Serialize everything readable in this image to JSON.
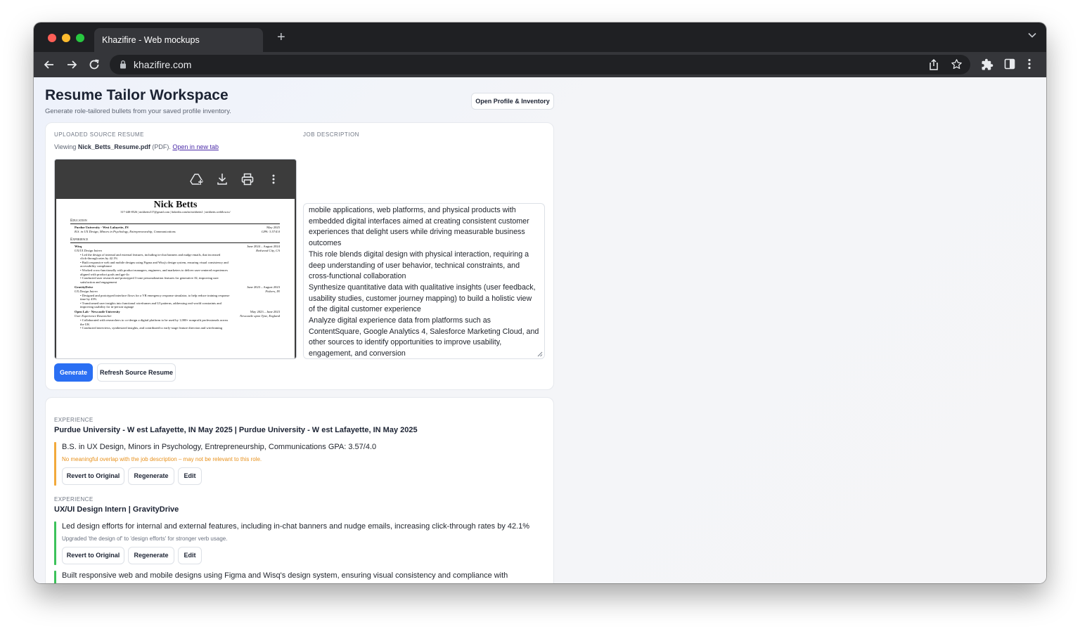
{
  "browser": {
    "tab_title": "Khazifire - Web mockups",
    "new_tab": "+",
    "url": "khazifire.com"
  },
  "header": {
    "title": "Resume Tailor Workspace",
    "subtitle": "Generate role-tailored bullets from your saved profile inventory.",
    "open_profile_button": "Open Profile & Inventory"
  },
  "source": {
    "section_label": "UPLOADED SOURCE RESUME",
    "viewing_prefix": "Viewing ",
    "file_name": "Nick_Betts_Resume.pdf",
    "file_type": " (PDF). ",
    "open_link": "Open in new tab"
  },
  "resume": {
    "name": "Nick Betts",
    "contact": "317-448-8526 | nickbetts317@gmail.com | linkedin.com/in/nickbetts1 | nickbetts.webflow.io/",
    "education_heading": "Education",
    "school": "Purdue University - West Lafayette, IN",
    "school_date": "May 2025",
    "degree": "B.S. in UX Design, Minors in Psychology, Entrepreneurship, Communications",
    "gpa": "GPA: 3.57/4.0",
    "experience_heading": "Experience",
    "jobs": [
      {
        "company": "Wisq",
        "dates": "June 2024 – August 2024",
        "role": "UX/UI Design Intern",
        "location": "Redwood City, CA",
        "bullets": [
          "• Led the design of internal and external features, including in-chat banners and nudge emails, that increased",
          "   click-through rates by 42.1%",
          "• Built responsive web and mobile designs using Figma and Wisq's design system, ensuring visual consistency and",
          "   accessibility compliance",
          "• Worked cross-functionally with product managers, engineers, and marketers to deliver user-centered experiences",
          "   aligned with product goals and gpt-4o",
          "• Conducted user research and prototyped 3 tone personalization features for generative AI, improving user",
          "   satisfaction and engagement"
        ]
      },
      {
        "company": "GravityDrive",
        "dates": "June 2023 – August 2023",
        "role": "UX Design Intern",
        "location": "Fishers, IN",
        "bullets": [
          "• Designed and prototyped interface flows for a VR emergency response simulator, to help reduce training response",
          "   time by 43%",
          "• Transformed user insights into functional wireframes and UI patterns, addressing real-world constraints and",
          "   improving usability for in-person signage"
        ]
      },
      {
        "company": "Open Lab - Newcastle University",
        "dates": "May 2023 – June 2023",
        "role": "User Experience Researcher",
        "location": "Newcastle upon Tyne, England",
        "bullets": [
          "• Collaborated with researchers to co-design a digital platform to be used by 1,000+ nonprofit professionals across",
          "   the UK",
          "• Conducted interviews, synthesized insights, and contributed to early-stage feature direction and wireframing"
        ]
      }
    ]
  },
  "job_description": {
    "section_label": "JOB DESCRIPTION",
    "text": [
      "mobile applications, web platforms, and physical products with embedded digital interfaces aimed at creating consistent customer experiences that delight users while driving measurable business outcomes",
      "This role blends digital design with physical interaction, requiring a deep understanding of user behavior, technical constraints, and cross-functional collaboration",
      "Synthesize quantitative data with qualitative insights (user feedback, usability studies, customer journey mapping) to build a holistic view of the digital customer experience",
      "Analyze digital experience data from platforms such as ContentSquare, Google Analytics 4, Salesforce Marketing Cloud, and other sources to identify opportunities to improve usability, engagement, and conversion"
    ]
  },
  "actions": {
    "generate": "Generate",
    "refresh": "Refresh Source Resume"
  },
  "results": [
    {
      "label": "EXPERIENCE",
      "title": "Purdue University - W est Lafayette, IN May 2025 | Purdue University - W est Lafayette, IN May 2025",
      "bullet": "B.S. in UX Design, Minors in Psychology, Entrepreneurship, Communications GPA: 3.57/4.0",
      "note": "No meaningful overlap with the job description – may not be relevant to this role.",
      "note_color": "#e8911c",
      "bar_color": "#f2a93b"
    },
    {
      "label": "EXPERIENCE",
      "title": "UX/UI Design Intern | GravityDrive",
      "bullet": "Led design efforts for internal and external features, including in-chat banners and nudge emails, increasing click-through rates by 42.1%",
      "note": "Upgraded 'the design of' to 'design efforts' for stronger verb usage.",
      "note_color": "#6b7280",
      "bar_color": "#3cc25a"
    },
    {
      "bullet": "Built responsive web and mobile designs using Figma and Wisq's design system, ensuring visual consistency and compliance with",
      "bar_color": "#3cc25a"
    }
  ],
  "result_buttons": {
    "revert": "Revert to Original",
    "regenerate": "Regenerate",
    "edit": "Edit"
  }
}
